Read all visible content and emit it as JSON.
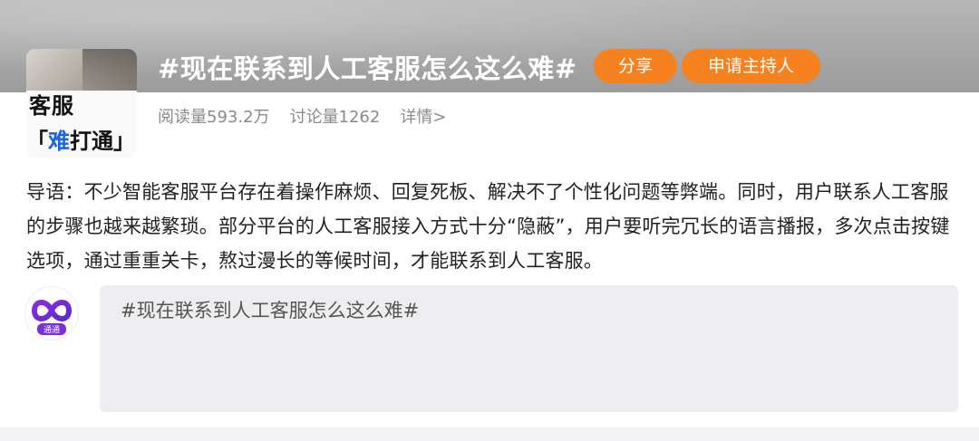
{
  "topic": {
    "title": "#现在联系到人工客服怎么这么难#",
    "cover_line1": "客服",
    "cover_line2_open": "「",
    "cover_line2_highlight": "难",
    "cover_line2_rest": "打通」",
    "highlight_color": "#1a63e0"
  },
  "actions": {
    "share_label": "分享",
    "apply_host_label": "申请主持人",
    "accent_color": "#f5811f"
  },
  "stats": {
    "reads": "阅读量593.2万",
    "discussions": "讨论量1262",
    "details": "详情>"
  },
  "intro": {
    "text": "导语：不少智能客服平台存在着操作麻烦、回复死板、解决不了个性化问题等弊端。同时，用户联系人工客服的步骤也越来越繁琐。部分平台的人工客服接入方式十分“隐蔽”，用户要听完冗长的语言播报，多次点击按键选项，通过重重关卡，熬过漫长的等候时间，才能联系到人工客服。"
  },
  "composer": {
    "text": "#现在联系到人工客服怎么这么难#",
    "avatar_label": "通通",
    "avatar_icon": "infinity-logo-icon"
  }
}
